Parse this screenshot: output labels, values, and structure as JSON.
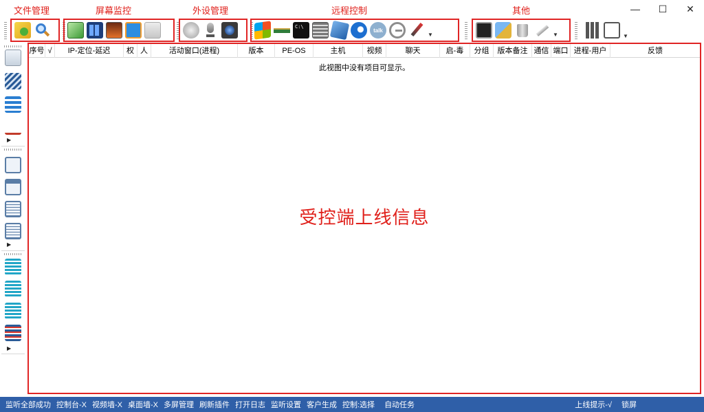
{
  "window": {
    "minimize": "—",
    "maximize": "☐",
    "close": "✕"
  },
  "groups": {
    "file": "文件管理",
    "screen": "屏幕监控",
    "peripheral": "外设管理",
    "remote": "远程控制",
    "other": "其他"
  },
  "toolbar_icons": {
    "file": [
      "folder-sync-icon",
      "magnifier-icon"
    ],
    "screen": [
      "screen-capture-icon",
      "screen-wall-icon",
      "desktop-view-icon",
      "monitor-icon",
      "mac-screen-icon"
    ],
    "peripheral": [
      "speaker-icon",
      "microphone-icon",
      "webcam-icon"
    ],
    "remote": [
      "windows-icon",
      "ram-module-icon",
      "cmd-icon",
      "calculator-icon",
      "puzzle-icon",
      "browser-icon",
      "talk-icon",
      "ie-icon",
      "pen-tool-icon"
    ],
    "other": [
      "terminal-icon",
      "registry-icon",
      "recycle-bin-icon",
      "syringe-icon"
    ],
    "extra": [
      "bar-chart-icon",
      "notebook-icon"
    ]
  },
  "columns": [
    "序号",
    "√",
    "IP-定位-延迟",
    "权",
    "人",
    "活动窗口(进程)",
    "版本",
    "PE-OS",
    "主机",
    "视频",
    "聊天",
    "启-毒",
    "分组",
    "版本备注",
    "通信",
    "端口",
    "进程-用户",
    "反馈"
  ],
  "list": {
    "empty_message": "此视图中没有项目可显示。",
    "caption": "受控端上线信息"
  },
  "status_bar": {
    "items": [
      "监听全部成功",
      "控制台-X",
      "视频墙-X",
      "桌面墙-X",
      "多屏管理",
      "刷新插件",
      "打开日志",
      "监听设置",
      "客户生成",
      "控制:选择",
      "自动任务"
    ],
    "right": [
      "上线提示-√",
      "锁屏"
    ]
  },
  "colors": {
    "accent_red": "#e02424",
    "status_blue": "#2f5fa8"
  }
}
